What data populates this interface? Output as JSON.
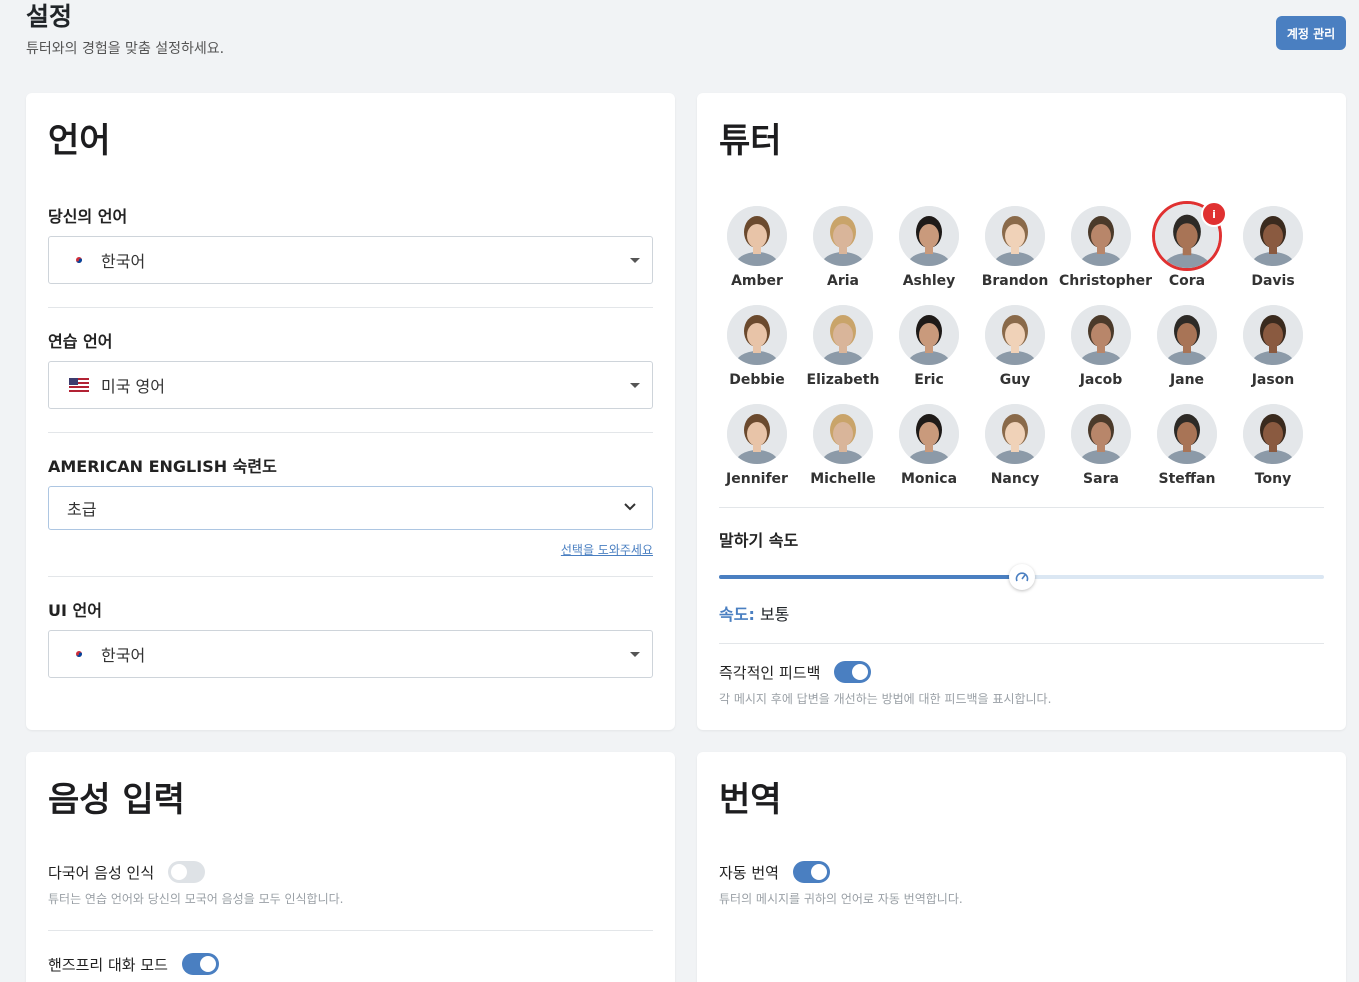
{
  "header": {
    "title": "설정",
    "subtitle": "튜터와의 경험을 맞춤 설정하세요.",
    "account_button": "계정 관리"
  },
  "language": {
    "title": "언어",
    "your_language_label": "당신의 언어",
    "your_language_value": "한국어",
    "practice_language_label": "연습 언어",
    "practice_language_value": "미국 영어",
    "proficiency_label": "AMERICAN ENGLISH 숙련도",
    "proficiency_value": "초급",
    "help_link": "선택을 도와주세요",
    "ui_language_label": "UI 언어",
    "ui_language_value": "한국어"
  },
  "tutor": {
    "title": "튜터",
    "selected": "Cora",
    "selected_badge": "i",
    "tutors": [
      "Amber",
      "Aria",
      "Ashley",
      "Brandon",
      "Christopher",
      "Cora",
      "Davis",
      "Debbie",
      "Elizabeth",
      "Eric",
      "Guy",
      "Jacob",
      "Jane",
      "Jason",
      "Jennifer",
      "Michelle",
      "Monica",
      "Nancy",
      "Sara",
      "Steffan",
      "Tony"
    ],
    "speed_label": "말하기 속도",
    "speed_prefix": "속도:",
    "speed_value": "보통",
    "speed_level_fraction": 0.5,
    "feedback_label": "즉각적인 피드백",
    "feedback_on": true,
    "feedback_desc": "각 메시지 후에 답변을 개선하는 방법에 대한 피드백을 표시합니다."
  },
  "voice": {
    "title": "음성 입력",
    "multilang_label": "다국어 음성 인식",
    "multilang_on": false,
    "multilang_desc": "튜터는 연습 언어와 당신의 모국어 음성을 모두 인식합니다.",
    "handsfree_label": "핸즈프리 대화 모드",
    "handsfree_on": true
  },
  "translation": {
    "title": "번역",
    "auto_label": "자동 번역",
    "auto_on": true,
    "auto_desc": "튜터의 메시지를 귀하의 언어로 자동 번역합니다."
  },
  "colors": {
    "accent": "#4a7fc1",
    "selected_ring": "#e03131"
  }
}
